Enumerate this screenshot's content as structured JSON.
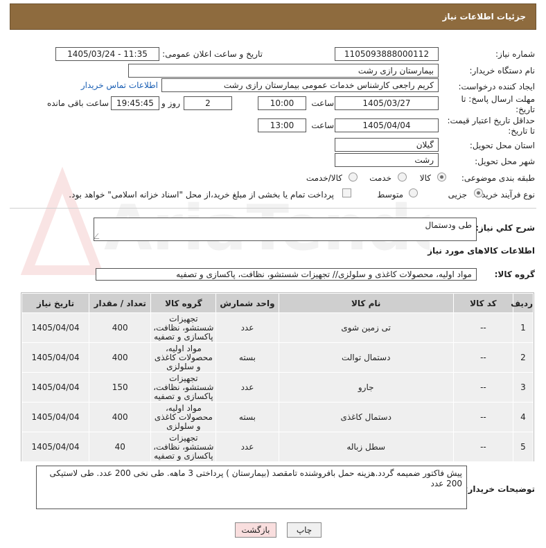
{
  "header": {
    "title": "جزئیات اطلاعات نیاز"
  },
  "fields": {
    "need_number_label": "شماره نیاز:",
    "need_number": "1105093888000112",
    "announce_label": "تاریخ و ساعت اعلان عمومی:",
    "announce_value": "1405/03/24 - 11:35",
    "buyer_org_label": "نام دستگاه خریدار:",
    "buyer_org": "بیمارستان رازی رشت",
    "requester_label": "ایجاد کننده درخواست:",
    "requester": "کریم راجعی کارشناس خدمات عمومی بیمارستان رازی رشت",
    "contact_link": "اطلاعات تماس خریدار",
    "deadline_label": "مهلت ارسال پاسخ: تا تاریخ:",
    "deadline_date": "1405/03/27",
    "time_label": "ساعت",
    "deadline_time": "10:00",
    "days_value": "2",
    "days_label": "روز و",
    "remaining_time": "19:45:45",
    "remaining_label": "ساعت باقی مانده",
    "validity_label": "حداقل تاریخ اعتبار قیمت: تا تاریخ:",
    "validity_date": "1405/04/04",
    "validity_time": "13:00",
    "province_label": "استان محل تحویل:",
    "province": "گیلان",
    "city_label": "شهر محل تحویل:",
    "city": "رشت",
    "category_label": "طبقه بندی موضوعی:",
    "category_options": [
      "کالا",
      "خدمت",
      "کالا/خدمت"
    ],
    "process_label": "نوع فرآیند خرید :",
    "process_options": [
      "جزیی",
      "متوسط"
    ],
    "payment_note": "پرداخت تمام یا بخشی از مبلغ خرید،از محل \"اسناد خزانه اسلامی\" خواهد بود."
  },
  "summary": {
    "label": "شرح کلي نياز:",
    "value": "طی ودستمال"
  },
  "goods_section": {
    "title": "اطلاعات کالاهای مورد نیاز",
    "group_label": "گروه کالا:",
    "group_value": "مواد اولیه، محصولات کاغذی و سلولزی// تجهیزات شستشو، نظافت، پاکسازی و تصفیه"
  },
  "table": {
    "headers": [
      "ردیف",
      "کد کالا",
      "نام کالا",
      "واحد شمارش",
      "گروه کالا",
      "تعداد / مقدار",
      "تاریخ نیاز"
    ],
    "rows": [
      [
        "1",
        "--",
        "تی زمین شوی",
        "عدد",
        "تجهیزات شستشو، نظافت، پاکسازی و تصفیه",
        "400",
        "1405/04/04"
      ],
      [
        "2",
        "--",
        "دستمال توالت",
        "بسته",
        "مواد اولیه، محصولات کاغذی و سلولزی",
        "400",
        "1405/04/04"
      ],
      [
        "3",
        "--",
        "جارو",
        "عدد",
        "تجهیزات شستشو، نظافت، پاکسازی و تصفیه",
        "150",
        "1405/04/04"
      ],
      [
        "4",
        "--",
        "دستمال کاغذی",
        "بسته",
        "مواد اولیه، محصولات کاغذی و سلولزی",
        "400",
        "1405/04/04"
      ],
      [
        "5",
        "--",
        "سطل زباله",
        "عدد",
        "تجهیزات شستشو، نظافت، پاکسازی و تصفیه",
        "40",
        "1405/04/04"
      ]
    ]
  },
  "buyer_notes": {
    "label": "توضیحات خریدار:",
    "value": "پیش فاکتور ضمیمه گردد.هزینه حمل بافروشنده تامقصد (بیمارستان ) پرداختی 3 ماهه. طی نخی 200 عدد. طی لاستیکی 200 عدد"
  },
  "buttons": {
    "print": "چاپ",
    "back": "بازگشت"
  },
  "watermark_text": "AriaTender.neT"
}
